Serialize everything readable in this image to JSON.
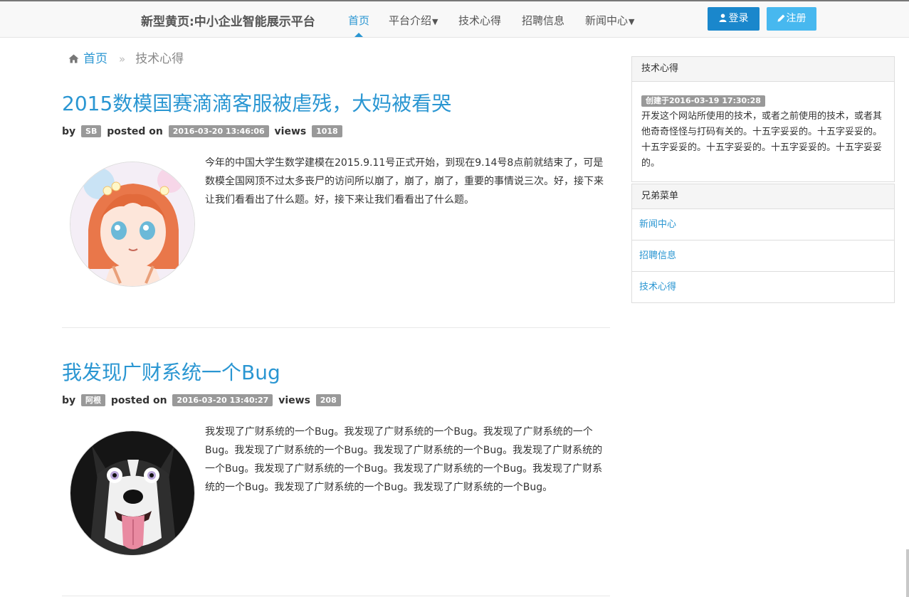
{
  "nav": {
    "brand": "新型黄页:中小企业智能展示平台",
    "items": [
      {
        "label": "首页",
        "dropdown": false,
        "active": true
      },
      {
        "label": "平台介绍",
        "dropdown": true,
        "active": false
      },
      {
        "label": "技术心得",
        "dropdown": false,
        "active": false
      },
      {
        "label": "招聘信息",
        "dropdown": false,
        "active": false
      },
      {
        "label": "新闻中心",
        "dropdown": true,
        "active": false
      }
    ],
    "login_label": "登录",
    "register_label": "注册",
    "user_icon": "user-icon",
    "pencil_icon": "pencil-icon"
  },
  "breadcrumb": {
    "home_icon": "home-icon",
    "home": "首页",
    "separator": "»",
    "current": "技术心得"
  },
  "posts": [
    {
      "title": "2015数模国赛滴滴客服被虐残，大妈被看哭",
      "by": "by",
      "author": "SB",
      "posted_on": "posted on",
      "date": "2016-03-20 13:46:06",
      "views_label": "views",
      "views": "1018",
      "image": "anime-girl-avatar",
      "excerpt": "今年的中国大学生数学建模在2015.9.11号正式开始，到现在9.14号8点前就结束了，可是数模全国网顶不过太多丧尸的访问所以崩了，崩了，崩了，重要的事情说三次。好，接下来让我们看看出了什么题。好，接下来让我们看看出了什么题。"
    },
    {
      "title": "我发现广财系统一个Bug",
      "by": "by",
      "author": "阿根",
      "posted_on": "posted on",
      "date": "2016-03-20 13:40:27",
      "views_label": "views",
      "views": "208",
      "image": "husky-dog-avatar",
      "excerpt": "我发现了广财系统的一个Bug。我发现了广财系统的一个Bug。我发现了广财系统的一个Bug。我发现了广财系统的一个Bug。我发现了广财系统的一个Bug。我发现了广财系统的一个Bug。我发现了广财系统的一个Bug。我发现了广财系统的一个Bug。我发现了广财系统的一个Bug。我发现了广财系统的一个Bug。我发现了广财系统的一个Bug。"
    }
  ],
  "sidebar": {
    "category_panel": {
      "title": "技术心得",
      "created": "创建于2016-03-19 17:30:28",
      "description": "开发这个网站所使用的技术，或者之前使用的技术，或者其他奇奇怪怪与打码有关的。十五字妥妥的。十五字妥妥的。十五字妥妥的。十五字妥妥的。十五字妥妥的。十五字妥妥的。"
    },
    "sibling_panel": {
      "title": "兄弟菜单",
      "items": [
        "新闻中心",
        "招聘信息",
        "技术心得"
      ]
    }
  },
  "colors": {
    "accent": "#2a96d2",
    "login_button": "#1a87cc",
    "register_button": "#47b8ef",
    "badge": "#999999"
  }
}
